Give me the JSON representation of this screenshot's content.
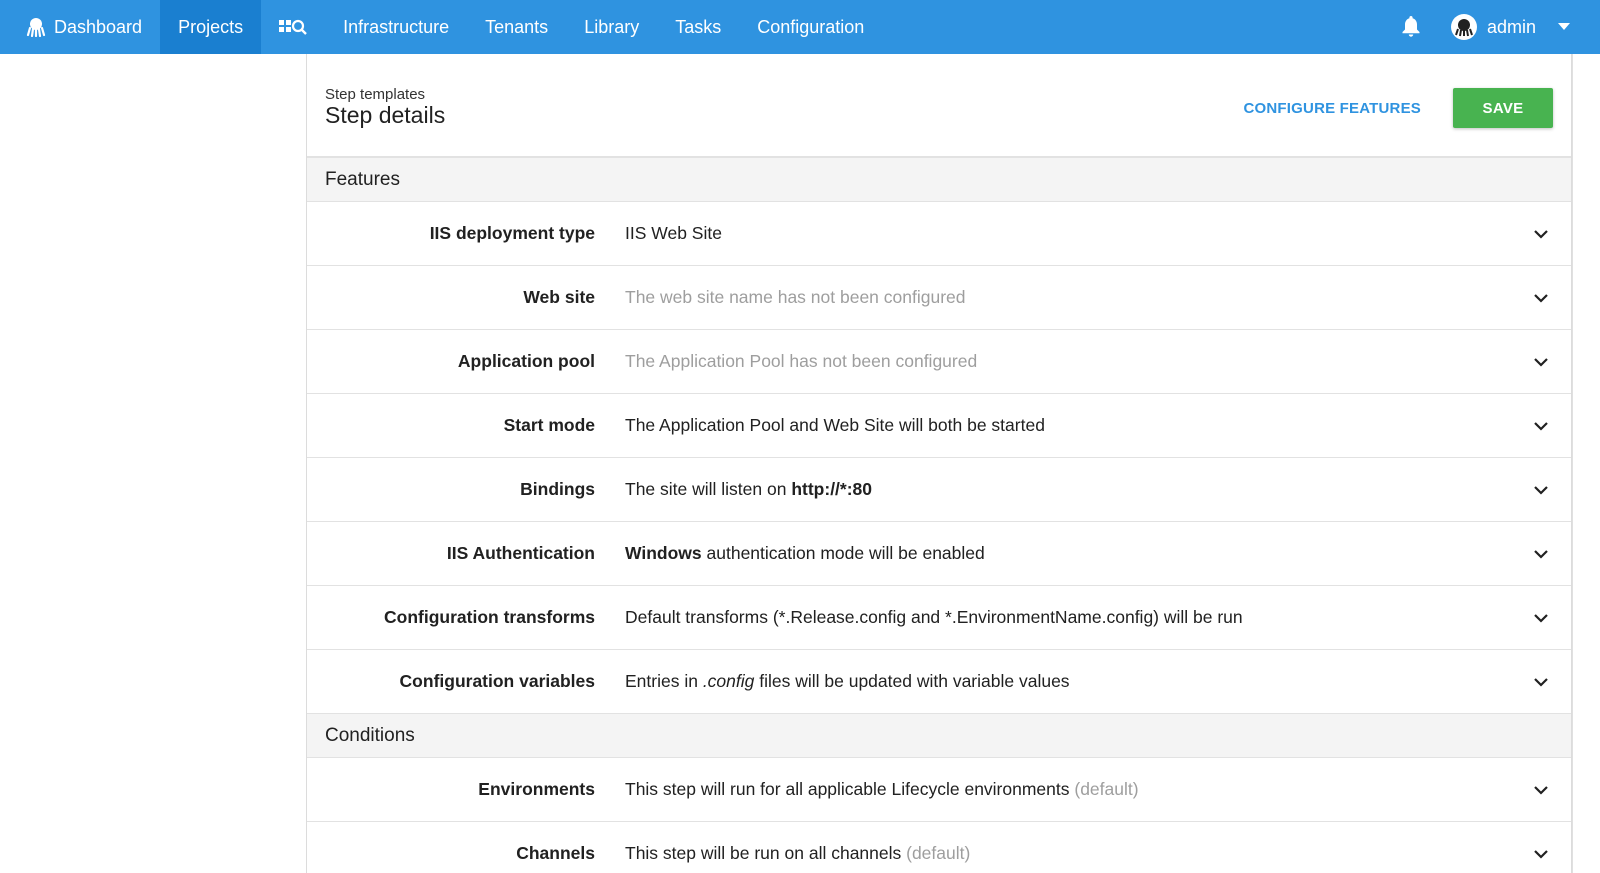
{
  "nav": {
    "items": [
      {
        "label": "Dashboard",
        "icon": "octopus-icon",
        "active": false
      },
      {
        "label": "Projects",
        "active": true
      },
      {
        "label": "",
        "icon": "search-dashboard-icon",
        "active": false
      },
      {
        "label": "Infrastructure",
        "active": false
      },
      {
        "label": "Tenants",
        "active": false
      },
      {
        "label": "Library",
        "active": false
      },
      {
        "label": "Tasks",
        "active": false
      },
      {
        "label": "Configuration",
        "active": false
      }
    ],
    "user": "admin",
    "bell_icon": "bell-icon",
    "accent": "#2f93e0",
    "active_bg": "#1a7fd0"
  },
  "header": {
    "breadcrumb": "Step templates",
    "title": "Step details",
    "configure_label": "CONFIGURE FEATURES",
    "save_label": "SAVE",
    "save_color": "#48b350"
  },
  "sections": [
    {
      "title": "Features",
      "rows": [
        {
          "label": "IIS deployment type",
          "value_html": [
            {
              "t": "IIS Web Site"
            }
          ],
          "muted": false
        },
        {
          "label": "Web site",
          "value_html": [
            {
              "t": "The web site name has not been configured"
            }
          ],
          "muted": true
        },
        {
          "label": "Application pool",
          "value_html": [
            {
              "t": "The Application Pool has not been configured"
            }
          ],
          "muted": true
        },
        {
          "label": "Start mode",
          "value_html": [
            {
              "t": "The Application Pool and Web Site will both be started"
            }
          ],
          "muted": false
        },
        {
          "label": "Bindings",
          "value_html": [
            {
              "t": "The site will listen on "
            },
            {
              "t": "http://*:80",
              "b": true
            }
          ],
          "muted": false
        },
        {
          "label": "IIS Authentication",
          "value_html": [
            {
              "t": "Windows",
              "b": true
            },
            {
              "t": " authentication mode will be enabled"
            }
          ],
          "muted": false
        },
        {
          "label": "Configuration transforms",
          "value_html": [
            {
              "t": "Default transforms (*.Release.config and *.EnvironmentName.config) will be run"
            }
          ],
          "muted": false
        },
        {
          "label": "Configuration variables",
          "value_html": [
            {
              "t": "Entries in "
            },
            {
              "t": ".config",
              "i": true
            },
            {
              "t": " files will be updated with variable values"
            }
          ],
          "muted": false
        }
      ]
    },
    {
      "title": "Conditions",
      "rows": [
        {
          "label": "Environments",
          "value_html": [
            {
              "t": "This step will run for all applicable Lifecycle environments "
            },
            {
              "t": "(default)",
              "m": true
            }
          ],
          "muted": false
        },
        {
          "label": "Channels",
          "value_html": [
            {
              "t": "This step will be run on all channels "
            },
            {
              "t": "(default)",
              "m": true
            }
          ],
          "muted": false
        }
      ]
    }
  ]
}
